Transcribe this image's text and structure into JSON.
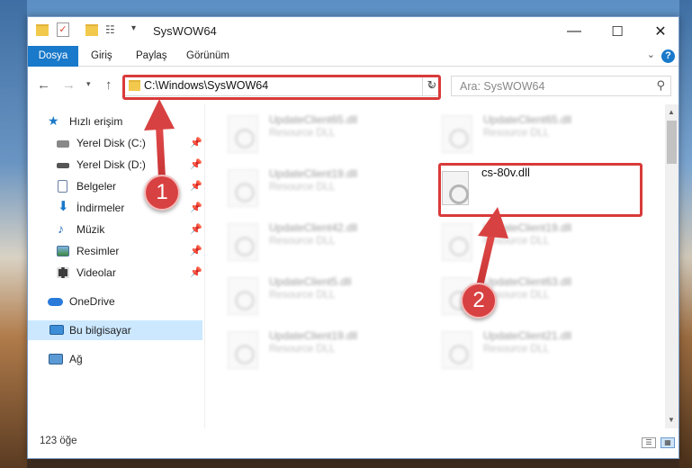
{
  "window": {
    "title": "SysWOW64",
    "minimize_glyph": "—",
    "maximize_glyph": "☐",
    "close_glyph": "✕"
  },
  "ribbon": {
    "tabs": [
      "Dosya",
      "Giriş",
      "Paylaş",
      "Görünüm"
    ],
    "help_glyph": "?"
  },
  "nav": {
    "back_icon": "arrow-left-icon",
    "forward_icon": "arrow-right-icon",
    "address": "C:\\Windows\\SysWOW64",
    "search_placeholder": "Ara: SysWOW64"
  },
  "sidebar": {
    "quick_access": "Hızlı erişim",
    "items": [
      {
        "label": "Yerel Disk (C:)",
        "icon": "drive-icon",
        "pinned": true
      },
      {
        "label": "Yerel Disk (D:)",
        "icon": "drive-icon",
        "pinned": true
      },
      {
        "label": "Belgeler",
        "icon": "documents-icon",
        "pinned": true
      },
      {
        "label": "İndirmeler",
        "icon": "downloads-icon",
        "pinned": true
      },
      {
        "label": "Müzik",
        "icon": "music-icon",
        "pinned": true
      },
      {
        "label": "Resimler",
        "icon": "pictures-icon",
        "pinned": true
      },
      {
        "label": "Videolar",
        "icon": "videos-icon",
        "pinned": true
      }
    ],
    "onedrive": "OneDrive",
    "this_pc": "Bu bilgisayar",
    "network": "Ağ"
  },
  "files": {
    "left_column": [
      {
        "name": "UpdateClient65.dll",
        "type": "Resource DLL"
      },
      {
        "name": "UpdateClient19.dll",
        "type": "Resource DLL"
      },
      {
        "name": "UpdateClient42.dll",
        "type": "Resource DLL"
      },
      {
        "name": "UpdateClient5.dll",
        "type": "Resource DLL"
      },
      {
        "name": "UpdateClient19.dll",
        "type": "Resource DLL"
      }
    ],
    "right_column": [
      {
        "name": "UpdateClient65.dll",
        "type": "Resource DLL"
      },
      {
        "name": "cs-80v.dll",
        "type": ""
      },
      {
        "name": "UpdateClient19.dll",
        "type": "Resource DLL"
      },
      {
        "name": "UpdateClient63.dll",
        "type": "Resource DLL"
      },
      {
        "name": "UpdateClient21.dll",
        "type": "Resource DLL"
      }
    ]
  },
  "status": {
    "count": "123 öğe"
  },
  "annotations": {
    "step1": "1",
    "step2": "2",
    "accent": "#d84141"
  }
}
